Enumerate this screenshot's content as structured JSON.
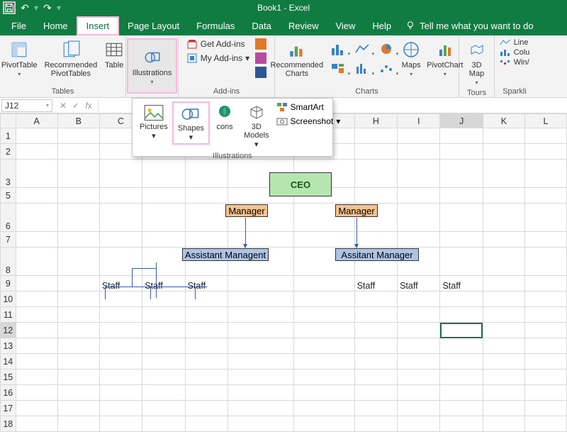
{
  "title": "Book1 - Excel",
  "qat": {
    "undo": "↶",
    "redo": "↷"
  },
  "tabs": [
    "File",
    "Home",
    "Insert",
    "Page Layout",
    "Formulas",
    "Data",
    "Review",
    "View",
    "Help"
  ],
  "active_tab": "Insert",
  "tell_me": "Tell me what you want to do",
  "ribbon": {
    "tables": {
      "pivot": "PivotTable",
      "recpivot": "Recommended\nPivotTables",
      "table": "Table",
      "label": "Tables"
    },
    "illustrations": {
      "btn": "Illustrations"
    },
    "addins": {
      "get": "Get Add-ins",
      "my": "My Add-ins",
      "label": "Add-ins"
    },
    "charts": {
      "rec": "Recommended\nCharts",
      "maps": "Maps",
      "pivotchart": "PivotChart",
      "label": "Charts"
    },
    "tours": {
      "map3d": "3D\nMap",
      "label": "Tours"
    },
    "sparklines": {
      "line": "Line",
      "column": "Colu",
      "winloss": "Win/",
      "label": "Sparkli"
    }
  },
  "popup": {
    "pictures": "Pictures",
    "shapes": "Shapes",
    "icons": "cons",
    "models": "3D\nModels",
    "smartart": "SmartArt",
    "screenshot": "Screenshot",
    "label": "Illustrations"
  },
  "namebox": "J12",
  "columns": [
    "A",
    "B",
    "C",
    "D",
    "E",
    "F",
    "G",
    "H",
    "I",
    "J",
    "K",
    "L"
  ],
  "rows": [
    "1",
    "2",
    "3",
    "5",
    "6",
    "7",
    "8",
    "9",
    "10",
    "11",
    "12",
    "13",
    "14",
    "15",
    "16",
    "17",
    "18"
  ],
  "tall_rows": [
    "3",
    "6",
    "8"
  ],
  "cells": {
    "C9": "Staff",
    "D9": "Staff",
    "E9": "Staff",
    "H9": "Staff",
    "I9": "Staff",
    "J9": "Staff"
  },
  "shapes": {
    "ceo": "CEO",
    "mgr1": "Manager",
    "mgr2": "Manager",
    "amgr1": "Assistant Managent",
    "amgr2": "Assitant Manager"
  },
  "selected_cell": "J12"
}
